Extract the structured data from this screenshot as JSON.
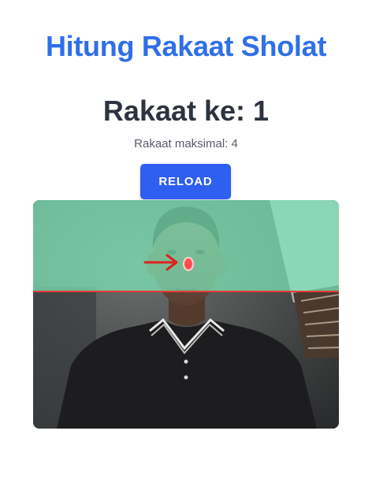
{
  "header": {
    "title": "Hitung Rakaat Sholat"
  },
  "counter": {
    "label": "Rakaat ke: 1"
  },
  "info": {
    "max_label": "Rakaat maksimal: 4"
  },
  "actions": {
    "reload_label": "RELOAD"
  },
  "camera_feed": {
    "icons": [
      "person-photo",
      "arrow-right-icon",
      "nose-marker"
    ],
    "colors": {
      "zone_overlay": "#7de8b8",
      "threshold_line": "#e53935",
      "marker": "#ff4d4d",
      "arrow": "#e02020"
    }
  },
  "colors": {
    "title": "#2f6fe8",
    "counter_text": "#2d3340",
    "button_bg": "#2f5ff0",
    "button_text": "#ffffff"
  }
}
